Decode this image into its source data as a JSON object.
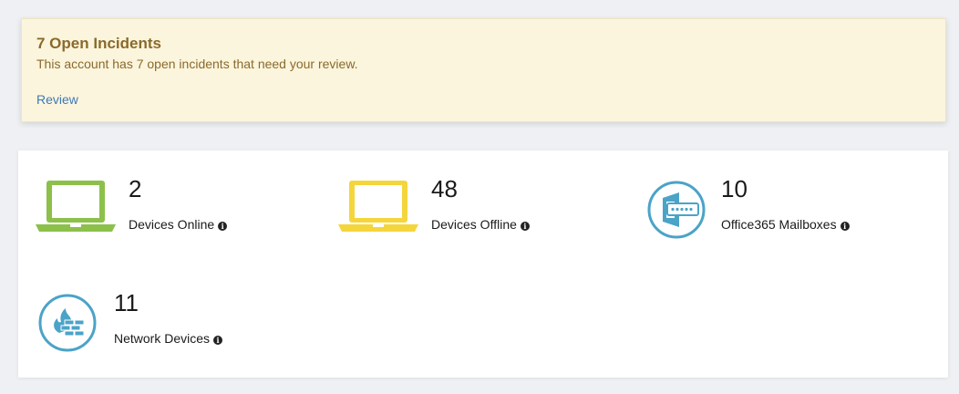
{
  "alert": {
    "title": "7 Open Incidents",
    "message": "This account has 7 open incidents that need your review.",
    "link": "Review"
  },
  "stats": [
    {
      "value": "2",
      "label": "Devices Online",
      "icon": "laptop-icon",
      "color": "#8cc04b"
    },
    {
      "value": "48",
      "label": "Devices Offline",
      "icon": "laptop-icon",
      "color": "#f4d63c"
    },
    {
      "value": "10",
      "label": "Office365 Mailboxes",
      "icon": "office365-mailbox-icon",
      "color": "#4ba3c8"
    },
    {
      "value": "11",
      "label": "Network Devices",
      "icon": "firewall-icon",
      "color": "#4ba3c8"
    }
  ],
  "info_glyph": "i"
}
